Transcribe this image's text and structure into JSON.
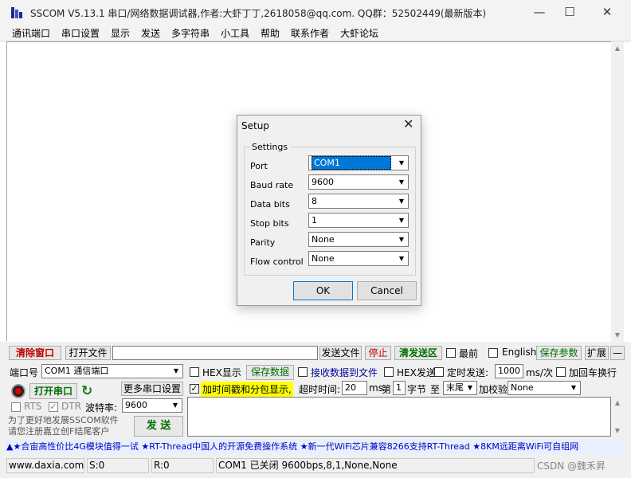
{
  "window": {
    "title": "SSCOM V5.13.1 串口/网络数据调试器,作者:大虾丁丁,2618058@qq.com. QQ群：52502449(最新版本)",
    "minimize": "—",
    "maximize": "☐",
    "close": "✕"
  },
  "menu": [
    "通讯端口",
    "串口设置",
    "显示",
    "发送",
    "多字符串",
    "小工具",
    "帮助",
    "联系作者",
    "大虾论坛"
  ],
  "toolbar": {
    "clear_window": "清除窗口",
    "open_file": "打开文件",
    "send_file": "发送文件",
    "stop": "停止",
    "clear_send": "清发送区",
    "topmost": "最前",
    "english": "English",
    "save_params": "保存参数",
    "expand": "扩展",
    "collapse": "—"
  },
  "port": {
    "label": "端口号",
    "value": "COM1 通信端口",
    "hex_display": "HEX显示",
    "save_data": "保存数据",
    "recv_to_file": "接收数据到文件",
    "hex_send": "HEX发送",
    "timed_send": "定时发送:",
    "interval": "1000",
    "interval_unit": "ms/次",
    "newline": "加回车换行",
    "open_port": "打开串口",
    "more_settings": "更多串口设置",
    "timestamp": "加时间戳和分包显示,",
    "timeout_label": "超时时间:",
    "timeout": "20",
    "ms": "ms",
    "nth": "第",
    "byte_idx": "1",
    "byte": "字节",
    "to": "至",
    "end_value": "末尾",
    "checksum": "加校验",
    "checksum_value": "None",
    "rts": "RTS",
    "dtr": "DTR",
    "baud_label": "波特率:",
    "baud_value": "9600",
    "promo_text": "为了更好地发展SSCOM软件\n请您注册嘉立创F结尾客户",
    "send": "发 送"
  },
  "ad": "▲★合宙高性价比4G模块值得一试 ★RT-Thread中国人的开源免费操作系统 ★新一代WiFi芯片兼容8266支持RT-Thread ★8KM远距离WiFi可自组网",
  "status": {
    "site": "www.daxia.com",
    "s": "S:0",
    "r": "R:0",
    "conn": "COM1 已关闭  9600bps,8,1,None,None",
    "watermark": "CSDN @魏禾昇"
  },
  "dialog": {
    "title": "Setup",
    "close": "✕",
    "group": "Settings",
    "fields": [
      {
        "label": "Port",
        "value": "COM1"
      },
      {
        "label": "Baud rate",
        "value": "9600"
      },
      {
        "label": "Data bits",
        "value": "8"
      },
      {
        "label": "Stop bits",
        "value": "1"
      },
      {
        "label": "Parity",
        "value": "None"
      },
      {
        "label": "Flow control",
        "value": "None"
      }
    ],
    "ok": "OK",
    "cancel": "Cancel"
  },
  "icons": {
    "app": "app-icon",
    "refresh": "refresh-icon",
    "record": "record-icon"
  },
  "colors": {
    "highlight": "#ffff00",
    "red_text": "#c00000",
    "green_text": "#007000",
    "selection": "#0078d7"
  }
}
